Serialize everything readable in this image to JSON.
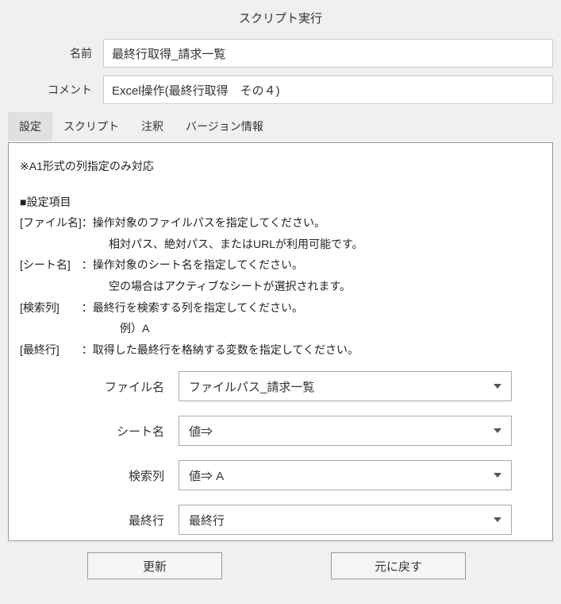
{
  "title": "スクリプト実行",
  "header": {
    "name_label": "名前",
    "name_value": "最終行取得_請求一覧",
    "comment_label": "コメント",
    "comment_value": "Excel操作(最終行取得　その４)"
  },
  "tabs": {
    "settings": "設定",
    "script": "スクリプト",
    "annotation": "注釈",
    "version": "バージョン情報"
  },
  "desc": {
    "line1": "※A1形式の列指定のみ対応",
    "heading": "■設定項目",
    "filename_line1": "[ファイル名]：操作対象のファイルパスを指定してください。",
    "filename_line2": "　　　　　　　　相対パス、絶対パス、またはURLが利用可能です。",
    "sheetname_line1": "[シート名]　：操作対象のシート名を指定してください。",
    "sheetname_line2": "　　　　　　　　空の場合はアクティブなシートが選択されます。",
    "searchcol_line1": "[検索列]　　：最終行を検索する列を指定してください。",
    "searchcol_line2": "　　　　　　　　　例）A",
    "lastrow_line1": "[最終行]　　：取得した最終行を格納する変数を指定してください。"
  },
  "form": {
    "filename_label": "ファイル名",
    "filename_value": "ファイルパス_請求一覧",
    "sheetname_label": "シート名",
    "sheetname_value": "値⇒",
    "searchcol_label": "検索列",
    "searchcol_value": "値⇒  A",
    "lastrow_label": "最終行",
    "lastrow_value": "最終行"
  },
  "buttons": {
    "update": "更新",
    "revert": "元に戻す"
  }
}
